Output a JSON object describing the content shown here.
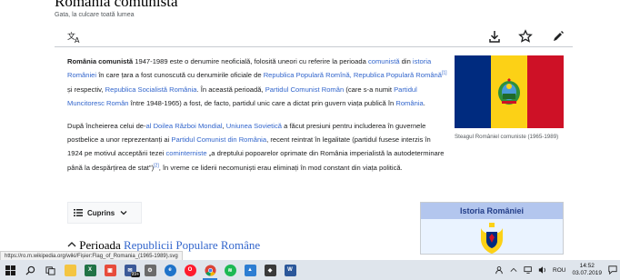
{
  "page": {
    "title": "România comunistă",
    "subtitle": "Gata, la culcare toată lumea"
  },
  "toolbar": {
    "icons": [
      "language-icon",
      "download-icon",
      "star-icon",
      "edit-icon"
    ]
  },
  "article": {
    "p1": {
      "bold": "România comunistă",
      "t1": " 1947-1989 este o denumire neoficială, folosită uneori cu referire la perioada ",
      "l1": "comunistă",
      "t2": " din ",
      "l2": "istoria României",
      "t3": " în care țara a fost cunoscută cu denumirile oficiale de ",
      "l3": "Republica Populară Romînă, Republica Populară Română",
      "ref1": "[1]",
      "t4": " și respectiv, ",
      "l4": "Republica Socialistă România",
      "t5": ". În această perioadă, ",
      "l5": "Partidul Comunist Român",
      "t6": " (care s-a numit ",
      "l6": "Partidul Muncitoresc Român",
      "t7": " între 1948-1965) a fost, de facto, partidul unic care a dictat prin guvern viața publică în ",
      "l7": "România",
      "t8": "."
    },
    "p2": {
      "t1": "După încheierea celui de-",
      "l1": "al Doilea Război Mondial",
      "t2": ", ",
      "l2": "Uniunea Sovietică",
      "t3": " a făcut presiuni pentru includerea în guvernele postbelice a unor reprezentanți ai ",
      "l3": "Partidul Comunist din România",
      "t4": ", recent reintrat în legalitate (partidul fusese interzis în 1924 pe motivul acceptării tezei ",
      "l4": "cominterniste",
      "t5": " „a dreptului popoarelor oprimate din România imperialistă la autodeterminare până la despărțirea de stat\")",
      "ref2": "[2]",
      "t6": ", în vreme ce liderii necomuniști erau eliminați în mod constant din viața politică."
    }
  },
  "infobox": {
    "caption": "Steagul Româniel comuniste (1965-1989)",
    "colors": {
      "blue": "#002b7f",
      "yellow": "#fcd116",
      "red": "#ce1126"
    }
  },
  "toc": {
    "label": "Cuprins"
  },
  "history_box": {
    "title": "Istoria României"
  },
  "section": {
    "heading_prefix": "Perioada ",
    "heading_link": "Republicii Populare Române"
  },
  "status_url": "https://ro.m.wikipedia.org/wiki/Fișier:Flag_of_Romania_(1965-1989).svg",
  "taskbar": {
    "badge": "99+",
    "language": "ROU",
    "time": "14:52",
    "date": "03.07.2019"
  }
}
